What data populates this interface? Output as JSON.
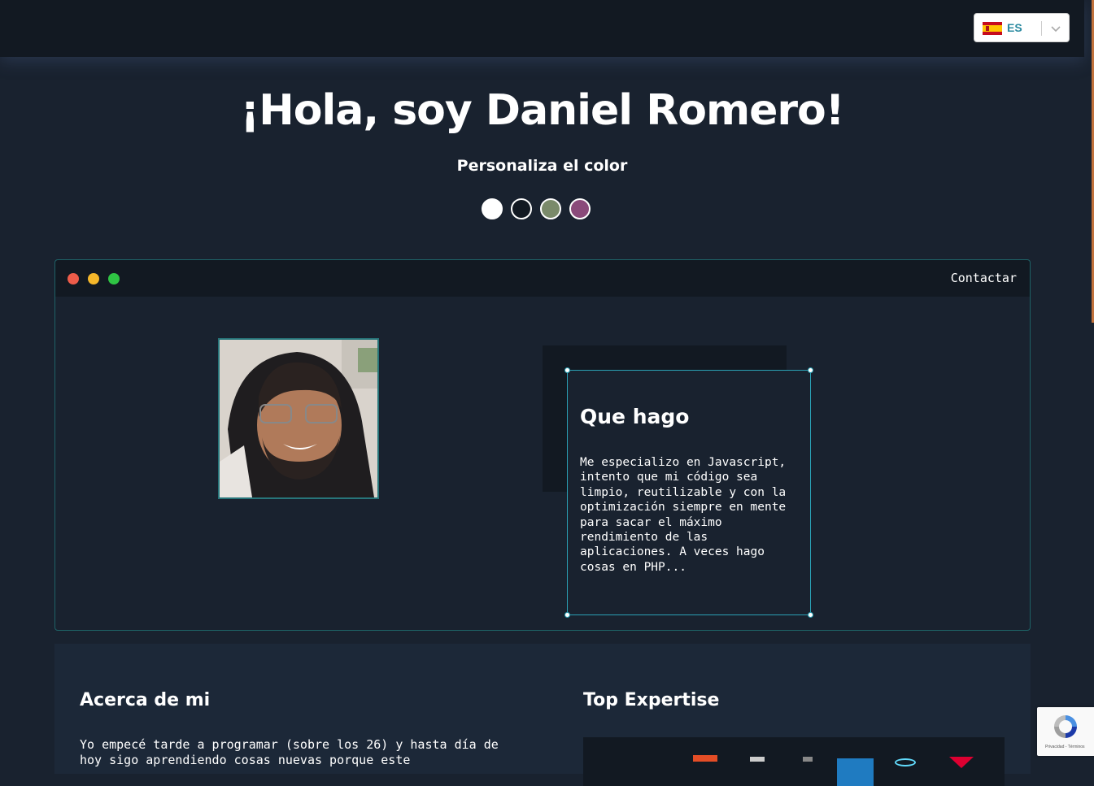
{
  "language_selector": {
    "code": "ES",
    "icon": "spain-flag-icon"
  },
  "hero": {
    "title": "¡Hola, soy Daniel Romero!",
    "subtitle": "Personaliza el color"
  },
  "color_swatches": [
    {
      "name": "white",
      "color": "#ffffff"
    },
    {
      "name": "dark",
      "color": "#121922"
    },
    {
      "name": "green",
      "color": "#7a8a6a"
    },
    {
      "name": "purple",
      "color": "#8a4a7a"
    }
  ],
  "window": {
    "controls": [
      "#ee5c4a",
      "#f5b72a",
      "#2fc444"
    ],
    "contact_link": "Contactar"
  },
  "que_hago": {
    "title": "Que hago",
    "text": "Me especializo en Javascript, intento que mi código sea limpio, reutilizable y con la optimización siempre en mente para sacar el máximo rendimiento de las aplicaciones. A veces hago cosas en PHP..."
  },
  "about": {
    "title": "Acerca de mi",
    "text": "Yo empecé tarde a programar (sobre los 26) y hasta día de hoy sigo aprendiendo cosas nuevas porque este"
  },
  "expertise": {
    "title": "Top Expertise"
  },
  "recaptcha": {
    "footer": "Privacidad - Términos"
  },
  "colors": {
    "accent": "#2aa1b5",
    "background": "#19222f",
    "scroll_accent": "#c1723c"
  }
}
